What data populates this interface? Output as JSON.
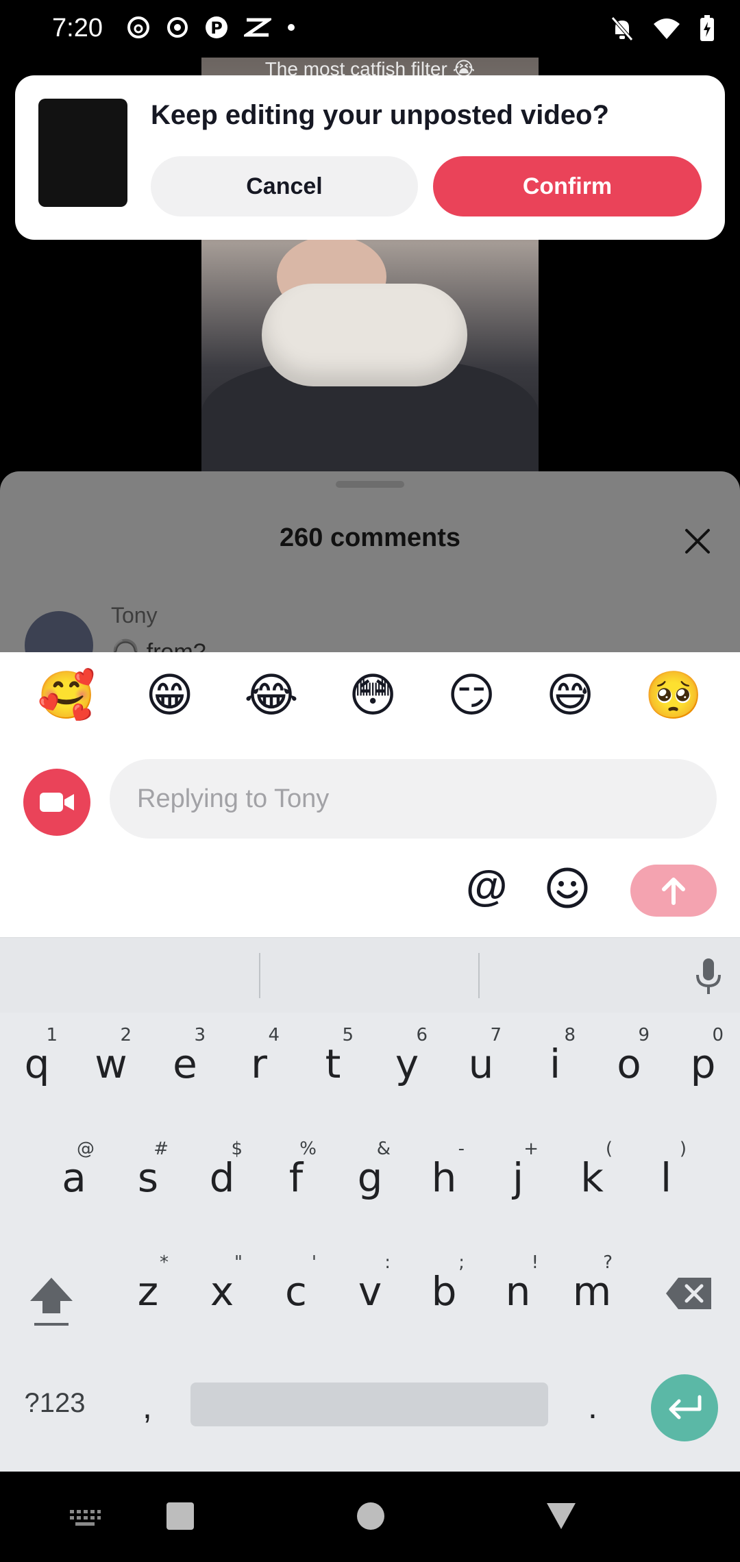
{
  "status_bar": {
    "time": "7:20"
  },
  "video": {
    "caption": "The most catfish filter 😭"
  },
  "dialog": {
    "title": "Keep editing your unposted video?",
    "cancel_label": "Cancel",
    "confirm_label": "Confirm"
  },
  "comments": {
    "title": "260 comments",
    "first_comment_user": "Tony",
    "first_comment_text": "🎧 from?"
  },
  "composer": {
    "emojis": [
      "🥰",
      "😁",
      "😂",
      "😳",
      "😏",
      "😅",
      "🥺"
    ],
    "placeholder": "Replying to Tony",
    "mention_label": "@"
  },
  "keyboard": {
    "row1": [
      {
        "k": "q",
        "h": "1"
      },
      {
        "k": "w",
        "h": "2"
      },
      {
        "k": "e",
        "h": "3"
      },
      {
        "k": "r",
        "h": "4"
      },
      {
        "k": "t",
        "h": "5"
      },
      {
        "k": "y",
        "h": "6"
      },
      {
        "k": "u",
        "h": "7"
      },
      {
        "k": "i",
        "h": "8"
      },
      {
        "k": "o",
        "h": "9"
      },
      {
        "k": "p",
        "h": "0"
      }
    ],
    "row2": [
      {
        "k": "a",
        "h": "@"
      },
      {
        "k": "s",
        "h": "#"
      },
      {
        "k": "d",
        "h": "$"
      },
      {
        "k": "f",
        "h": "%"
      },
      {
        "k": "g",
        "h": "&"
      },
      {
        "k": "h",
        "h": "-"
      },
      {
        "k": "j",
        "h": "+"
      },
      {
        "k": "k",
        "h": "("
      },
      {
        "k": "l",
        "h": ")"
      }
    ],
    "row3": [
      {
        "k": "z",
        "h": "*"
      },
      {
        "k": "x",
        "h": "\""
      },
      {
        "k": "c",
        "h": "'"
      },
      {
        "k": "v",
        "h": ":"
      },
      {
        "k": "b",
        "h": ";"
      },
      {
        "k": "n",
        "h": "!"
      },
      {
        "k": "m",
        "h": "?"
      }
    ],
    "symbols_label": "?123",
    "comma_label": ",",
    "period_label": "."
  },
  "colors": {
    "accent": "#ea4359",
    "send_disabled": "#f4a3b0",
    "enter_key": "#5bb8a6"
  }
}
